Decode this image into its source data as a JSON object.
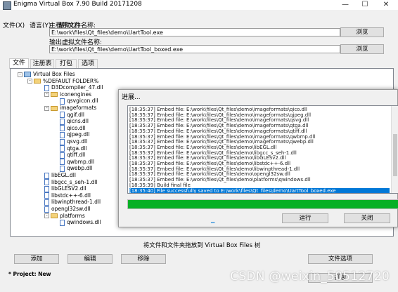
{
  "window": {
    "title": "Enigma Virtual Box 7.90 Build 20171208",
    "minimize": "—",
    "maximize": "☐",
    "close": "✕"
  },
  "menu": [
    "文件(X)",
    "语言(Y)",
    "帮助(Z)"
  ],
  "input_file": {
    "label": "主程序文件名称:",
    "value": "E:\\work\\files\\Qt_files\\demo\\UartTool.exe",
    "browse": "浏览"
  },
  "output_file": {
    "label": "输出虚拟文件名称:",
    "value": "E:\\work\\files\\Qt_files\\demo\\UartTool_boxed.exe",
    "browse": "浏览"
  },
  "tabs": [
    "文件",
    "注册表",
    "打包",
    "选项"
  ],
  "tree": [
    {
      "label": "Virtual Box Files",
      "level": 0,
      "kind": "root",
      "expander": "-"
    },
    {
      "label": "%DEFAULT FOLDER%",
      "level": 1,
      "kind": "folder",
      "expander": "-"
    },
    {
      "label": "D3Dcompiler_47.dll",
      "level": 2,
      "kind": "file"
    },
    {
      "label": "iconengines",
      "level": 2,
      "kind": "folder",
      "expander": "-"
    },
    {
      "label": "qsvgicon.dll",
      "level": 3,
      "kind": "file"
    },
    {
      "label": "imageformats",
      "level": 2,
      "kind": "folder",
      "expander": "-"
    },
    {
      "label": "qgif.dll",
      "level": 3,
      "kind": "file"
    },
    {
      "label": "qicns.dll",
      "level": 3,
      "kind": "file"
    },
    {
      "label": "qico.dll",
      "level": 3,
      "kind": "file"
    },
    {
      "label": "qjpeg.dll",
      "level": 3,
      "kind": "file"
    },
    {
      "label": "qsvg.dll",
      "level": 3,
      "kind": "file"
    },
    {
      "label": "qtga.dll",
      "level": 3,
      "kind": "file"
    },
    {
      "label": "qtiff.dll",
      "level": 3,
      "kind": "file"
    },
    {
      "label": "qwbmp.dll",
      "level": 3,
      "kind": "file"
    },
    {
      "label": "qwebp.dll",
      "level": 3,
      "kind": "file"
    },
    {
      "label": "libEGL.dll",
      "level": 2,
      "kind": "file"
    },
    {
      "label": "libgcc_s_seh-1.dll",
      "level": 2,
      "kind": "file"
    },
    {
      "label": "libGLESV2.dll",
      "level": 2,
      "kind": "file"
    },
    {
      "label": "libstdc++-6.dll",
      "level": 2,
      "kind": "file"
    },
    {
      "label": "libwinpthread-1.dll",
      "level": 2,
      "kind": "file"
    },
    {
      "label": "opengl32sw.dll",
      "level": 2,
      "kind": "file"
    },
    {
      "label": "platforms",
      "level": 2,
      "kind": "folder",
      "expander": "-"
    },
    {
      "label": "qwindows.dll",
      "level": 3,
      "kind": "file"
    }
  ],
  "drop_hint": "将文件和文件夹拖放到 Virtual Box Files 树",
  "buttons": {
    "add": "添加",
    "edit": "编辑",
    "remove": "移除",
    "file_options": "文件选项",
    "process": "打包"
  },
  "status": "* Project: New",
  "watermark": "CSDN @weixin_50512720",
  "dialog": {
    "title": "进展...",
    "log": [
      "[18:35:37] Embed file: E:\\work\\files\\Qt_files\\demo\\imageformats\\qico.dll",
      "[18:35:37] Embed file: E:\\work\\files\\Qt_files\\demo\\imageformats\\qjpeg.dll",
      "[18:35:37] Embed file: E:\\work\\files\\Qt_files\\demo\\imageformats\\qsvg.dll",
      "[18:35:37] Embed file: E:\\work\\files\\Qt_files\\demo\\imageformats\\qtga.dll",
      "[18:35:37] Embed file: E:\\work\\files\\Qt_files\\demo\\imageformats\\qtiff.dll",
      "[18:35:37] Embed file: E:\\work\\files\\Qt_files\\demo\\imageformats\\qwbmp.dll",
      "[18:35:37] Embed file: E:\\work\\files\\Qt_files\\demo\\imageformats\\qwebp.dll",
      "[18:35:37] Embed file: E:\\work\\files\\Qt_files\\demo\\libEGL.dll",
      "[18:35:37] Embed file: E:\\work\\files\\Qt_files\\demo\\libgcc_s_seh-1.dll",
      "[18:35:37] Embed file: E:\\work\\files\\Qt_files\\demo\\libGLESv2.dll",
      "[18:35:37] Embed file: E:\\work\\files\\Qt_files\\demo\\libstdc++-6.dll",
      "[18:35:37] Embed file: E:\\work\\files\\Qt_files\\demo\\libwinpthread-1.dll",
      "[18:35:37] Embed file: E:\\work\\files\\Qt_files\\demo\\opengl32sw.dll",
      "[18:35:37] Embed file: E:\\work\\files\\Qt_files\\demo\\platforms\\qwindows.dll",
      "[18:35:39] Build final file",
      "[18:35:40] File successfully saved to E:\\work\\files\\Qt_files\\demo\\UartTool_boxed.exe"
    ],
    "progress": 1.0,
    "run_label": "运行",
    "close_label": "关闭",
    "progress_color": "#06b025",
    "selection_color": "#0078d7"
  }
}
